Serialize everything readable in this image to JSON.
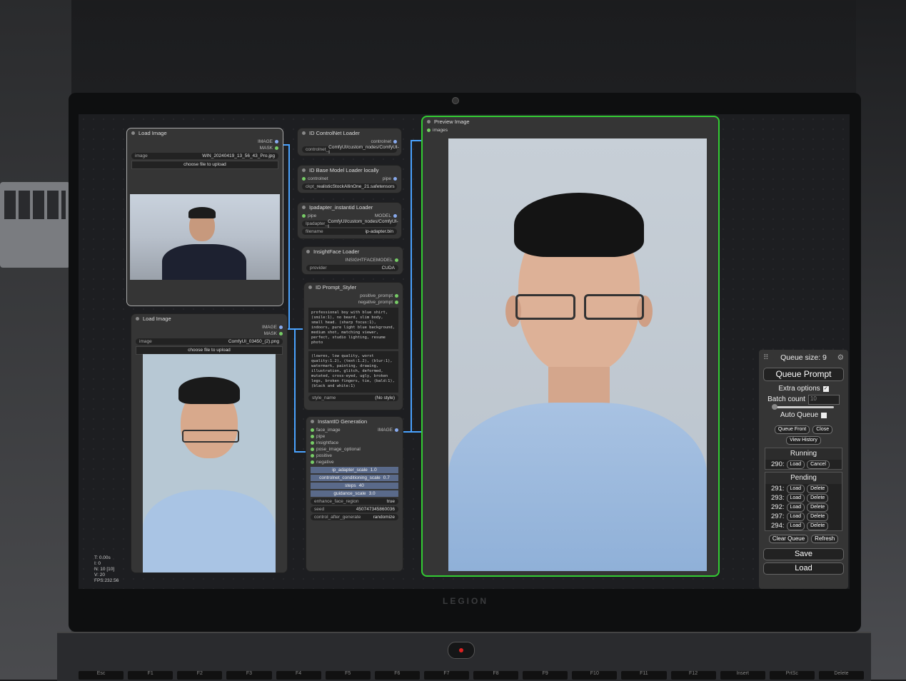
{
  "queue_panel": {
    "queue_size_label": "Queue size: 9",
    "queue_prompt_label": "Queue Prompt",
    "extra_options_label": "Extra options",
    "batch_count_label": "Batch count",
    "batch_count_value": "10",
    "auto_queue_label": "Auto Queue",
    "queue_front_label": "Queue Front",
    "close_label": "Close",
    "view_history_label": "View History",
    "running_label": "Running",
    "running_items": [
      {
        "id": "290:",
        "load": "Load",
        "action": "Cancel"
      }
    ],
    "pending_label": "Pending",
    "pending_items": [
      {
        "id": "291:",
        "load": "Load",
        "action": "Delete"
      },
      {
        "id": "293:",
        "load": "Load",
        "action": "Delete"
      },
      {
        "id": "292:",
        "load": "Load",
        "action": "Delete"
      },
      {
        "id": "297:",
        "load": "Load",
        "action": "Delete"
      },
      {
        "id": "294:",
        "load": "Load",
        "action": "Delete"
      }
    ],
    "clear_queue_label": "Clear Queue",
    "refresh_label": "Refresh",
    "save_label": "Save",
    "load_label": "Load"
  },
  "nodes": {
    "load_image_1": {
      "title": "Load Image",
      "out_image": "IMAGE",
      "out_mask": "MASK",
      "image_key": "image",
      "image_value": "WIN_20240419_13_56_43_Pro.jpg",
      "upload_label": "choose file to upload"
    },
    "load_image_2": {
      "title": "Load Image",
      "out_image": "IMAGE",
      "out_mask": "MASK",
      "image_key": "image",
      "image_value": "ComfyUI_03450_(2).png",
      "upload_label": "choose file to upload"
    },
    "controlnet_loader": {
      "title": "ID ControlNet Loader",
      "out": "controlnet",
      "key": "controlnet_",
      "value": "ComfyUI/custom_nodes/ComfyUI-I"
    },
    "base_model_loader": {
      "title": "ID Base Model Loader locally",
      "in": "controlnet",
      "out": "pipe",
      "key": "ckpt_",
      "value": "realisticStockAllinOne_21.safetensors"
    },
    "ipadapter_loader": {
      "title": "Ipadapter_instantid Loader",
      "in": "pipe",
      "out": "MODEL",
      "key1": "Ipadapter_",
      "value1": "ComfyUI/custom_nodes/ComfyUI-I",
      "key2": "filename",
      "value2": "ip-adapter.bin"
    },
    "insightface_loader": {
      "title": "InsightFace Loader",
      "out": "INSIGHTFACEMODEL",
      "key": "provider",
      "value": "CUDA"
    },
    "prompt_styler": {
      "title": "ID Prompt_Styler",
      "out_pos": "positive_prompt",
      "out_neg": "negative_prompt",
      "positive_text": "professional boy with blue shirt, (smile:1), no beard, slim body, small head. (sharp focus:1), indoors, pure light blue background, medium shot, matching viewer, perfect, studio lighting, resume photo",
      "negative_text": "(lowres, low quality, worst quality:1.2), (text:1.2), (blur:1), watermark, painting, drawing, illustration, glitch, deformed, mutated, cross-eyed, ugly, broken legs, broken fingers, tie, (bald:1), (black and white:1)",
      "style_key": "style_name",
      "style_value": "(No style)"
    },
    "instantid_generation": {
      "title": "InstantID Generation",
      "inputs": [
        "face_image",
        "pipe",
        "insightface",
        "pose_image_optional",
        "positive",
        "negative"
      ],
      "out": "IMAGE",
      "sliders": [
        {
          "key": "ip_adapter_scale",
          "value": "1.0"
        },
        {
          "key": "controlnet_conditioning_scale",
          "value": "0.7"
        },
        {
          "key": "steps",
          "value": "40"
        },
        {
          "key": "guidance_scale",
          "value": "3.0"
        }
      ],
      "widgets": [
        {
          "key": "enhance_face_region",
          "value": "true"
        },
        {
          "key": "seed",
          "value": "450747345860036"
        },
        {
          "key": "control_after_generate",
          "value": "randomize"
        }
      ]
    },
    "preview_image": {
      "title": "Preview Image",
      "in": "images"
    }
  },
  "stats": {
    "lines": [
      "T: 0.00s",
      "I: 0",
      "N: 10 [10]",
      "V: 20",
      "FPS:232.56"
    ]
  },
  "laptop": {
    "brand": "LEGION",
    "keys": [
      "Esc",
      "F1",
      "F2",
      "F3",
      "F4",
      "F5",
      "F6",
      "F7",
      "F8",
      "F9",
      "F10",
      "F11",
      "F12",
      "Insert",
      "PrtSc",
      "Delete"
    ]
  }
}
